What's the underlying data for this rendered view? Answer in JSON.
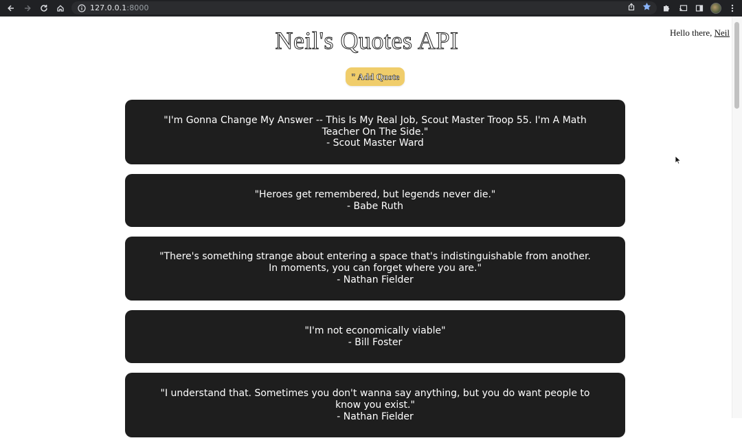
{
  "browser": {
    "url_host": "127.0.0.1",
    "url_port": ":8000",
    "icons": [
      "back-icon",
      "forward-icon",
      "reload-icon",
      "home-icon",
      "info-icon",
      "share-icon",
      "bookmark-star-icon",
      "extensions-icon",
      "cast-icon",
      "side-panel-icon",
      "profile-avatar",
      "menu-icon"
    ]
  },
  "page": {
    "title": "Neil's Quotes API",
    "add_button": "\" Add Quote",
    "greeting_prefix": "Hello there, ",
    "greeting_user": "Neil"
  },
  "quotes": [
    {
      "text": "\"I'm Gonna Change My Answer -- This Is My Real Job, Scout Master Troop 55. I'm A Math Teacher On The Side.\"",
      "author": "- Scout Master Ward"
    },
    {
      "text": "\"Heroes get remembered, but legends never die.\"",
      "author": "- Babe Ruth"
    },
    {
      "text": "\"There's something strange about entering a space that's indistinguishable from another. In moments, you can forget where you are.\"",
      "author": "- Nathan Fielder"
    },
    {
      "text": "\"I'm not economically viable\"",
      "author": "- Bill Foster"
    },
    {
      "text": "\"I understand that. Sometimes you don't wanna say anything, but you do want people to know you exist.\"",
      "author": "- Nathan Fielder"
    }
  ],
  "colors": {
    "card_bg": "#1e1e1e",
    "add_button_bg": "#f0cd6b",
    "chrome_bg": "#202124",
    "bookmark_star": "#8ab4f8"
  }
}
